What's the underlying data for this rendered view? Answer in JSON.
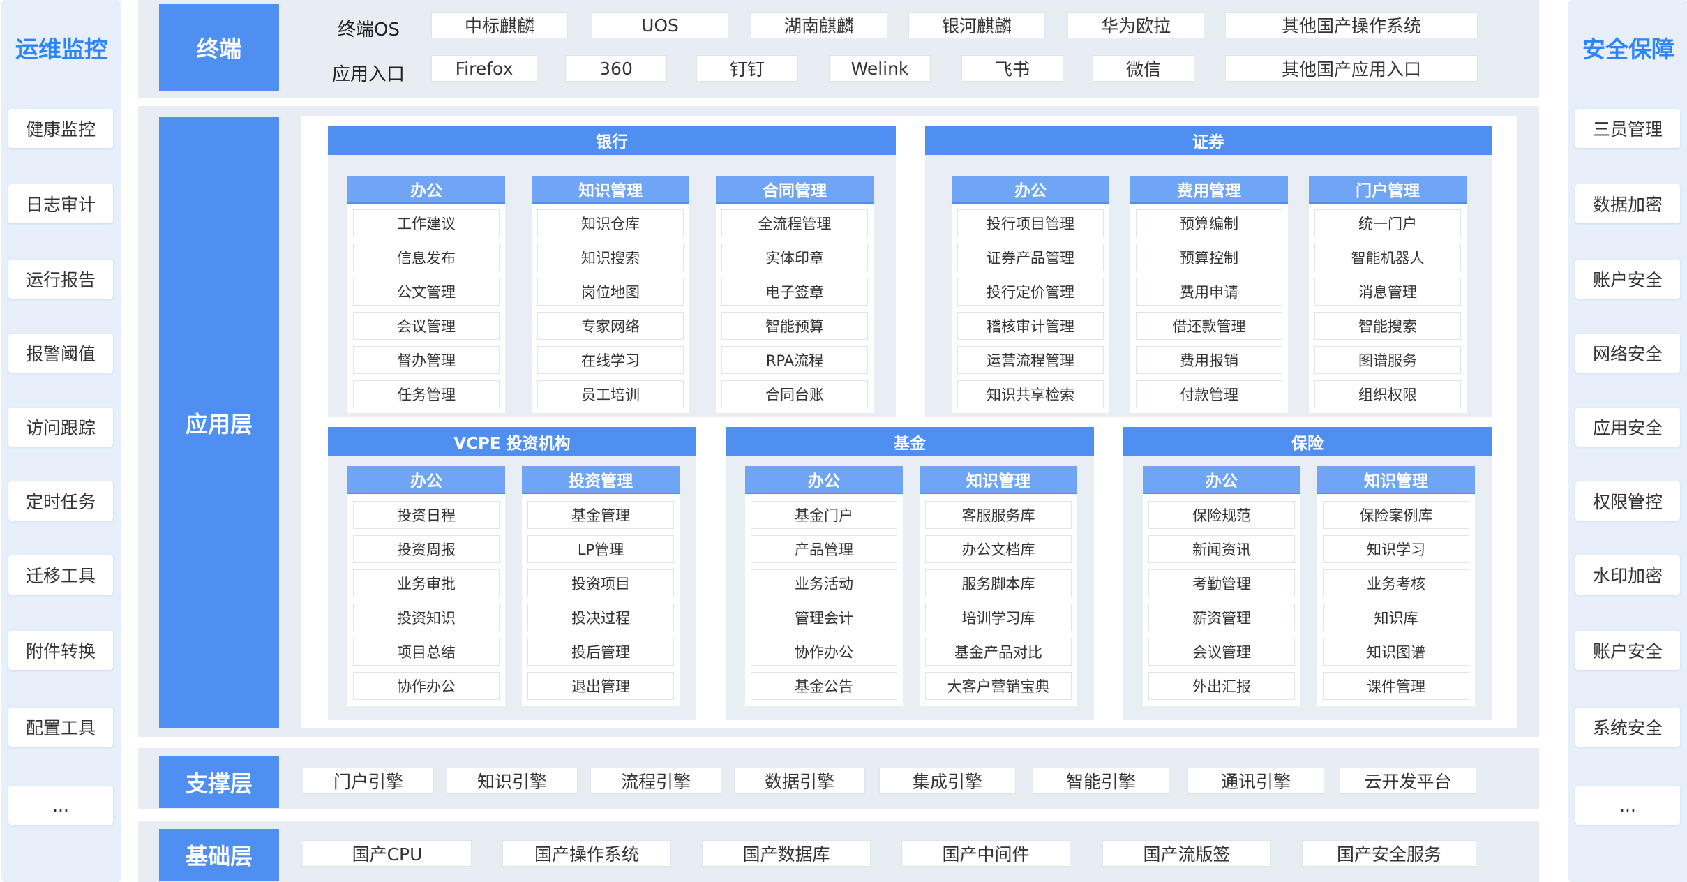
{
  "left_sidebar": {
    "title": "运维监控",
    "items": [
      "健康监控",
      "日志审计",
      "运行报告",
      "报警阈值",
      "访问跟踪",
      "定时任务",
      "迁移工具",
      "附件转换",
      "配置工具",
      "..."
    ]
  },
  "right_sidebar": {
    "title": "安全保障",
    "items": [
      "三员管理",
      "数据加密",
      "账户安全",
      "网络安全",
      "应用安全",
      "权限管控",
      "水印加密",
      "账户安全",
      "系统安全",
      "..."
    ]
  },
  "terminal": {
    "label": "终端",
    "os_label": "终端OS",
    "os_items": [
      "中标麒麟",
      "UOS",
      "湖南麒麟",
      "银河麒麟",
      "华为欧拉",
      "其他国产操作系统"
    ],
    "app_label": "应用入口",
    "app_items": [
      "Firefox",
      "360",
      "钉钉",
      "Welink",
      "飞书",
      "微信",
      "其他国产应用入口"
    ]
  },
  "application_layer": {
    "label": "应用层",
    "groups": [
      {
        "title": "银行",
        "categories": [
          {
            "title": "办公",
            "items": [
              "工作建议",
              "信息发布",
              "公文管理",
              "会议管理",
              "督办管理",
              "任务管理"
            ]
          },
          {
            "title": "知识管理",
            "items": [
              "知识仓库",
              "知识搜索",
              "岗位地图",
              "专家网络",
              "在线学习",
              "员工培训"
            ]
          },
          {
            "title": "合同管理",
            "items": [
              "全流程管理",
              "实体印章",
              "电子签章",
              "智能预算",
              "RPA流程",
              "合同台账"
            ]
          }
        ]
      },
      {
        "title": "证券",
        "categories": [
          {
            "title": "办公",
            "items": [
              "投行项目管理",
              "证券产品管理",
              "投行定价管理",
              "稽核审计管理",
              "运营流程管理",
              "知识共享检索"
            ]
          },
          {
            "title": "费用管理",
            "items": [
              "预算编制",
              "预算控制",
              "费用申请",
              "借还款管理",
              "费用报销",
              "付款管理"
            ]
          },
          {
            "title": "门户管理",
            "items": [
              "统一门户",
              "智能机器人",
              "消息管理",
              "智能搜索",
              "图谱服务",
              "组织权限"
            ]
          }
        ]
      },
      {
        "title": "VCPE 投资机构",
        "categories": [
          {
            "title": "办公",
            "items": [
              "投资日程",
              "投资周报",
              "业务审批",
              "投资知识",
              "项目总结",
              "协作办公"
            ]
          },
          {
            "title": "投资管理",
            "items": [
              "基金管理",
              "LP管理",
              "投资项目",
              "投决过程",
              "投后管理",
              "退出管理"
            ]
          }
        ]
      },
      {
        "title": "基金",
        "categories": [
          {
            "title": "办公",
            "items": [
              "基金门户",
              "产品管理",
              "业务活动",
              "管理会计",
              "协作办公",
              "基金公告"
            ]
          },
          {
            "title": "知识管理",
            "items": [
              "客服服务库",
              "办公文档库",
              "服务脚本库",
              "培训学习库",
              "基金产品对比",
              "大客户营销宝典"
            ]
          }
        ]
      },
      {
        "title": "保险",
        "categories": [
          {
            "title": "办公",
            "items": [
              "保险规范",
              "新闻资讯",
              "考勤管理",
              "薪资管理",
              "会议管理",
              "外出汇报"
            ]
          },
          {
            "title": "知识管理",
            "items": [
              "保险案例库",
              "知识学习",
              "业务考核",
              "知识库",
              "知识图谱",
              "课件管理"
            ]
          }
        ]
      }
    ]
  },
  "support_layer": {
    "label": "支撑层",
    "items": [
      "门户引擎",
      "知识引擎",
      "流程引擎",
      "数据引擎",
      "集成引擎",
      "智能引擎",
      "通讯引擎",
      "云开发平台"
    ]
  },
  "base_layer": {
    "label": "基础层",
    "items": [
      "国产CPU",
      "国产操作系统",
      "国产数据库",
      "国产中间件",
      "国产流版签",
      "国产安全服务"
    ]
  },
  "colors": {
    "accent": "#4f8ff2",
    "accent_light": "#6fa5f4",
    "sidebar_bg": "#e7effb",
    "sidebar_title": "#2d84ff",
    "band_bg": "#e8ecf3"
  }
}
